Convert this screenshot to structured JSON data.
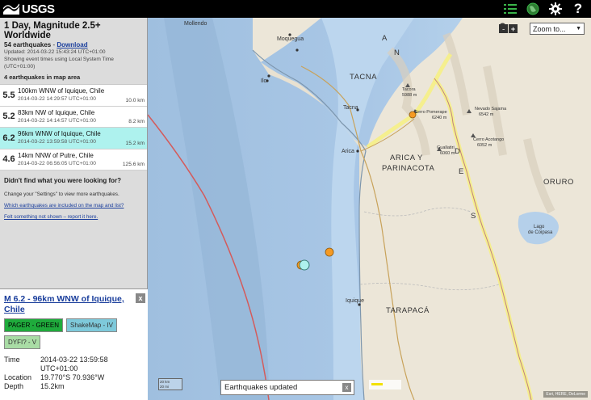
{
  "header": {
    "logo_text": "USGS",
    "icons": [
      "list-icon",
      "globe-icon",
      "gear-icon",
      "help-icon"
    ],
    "help_glyph": "?"
  },
  "summary": {
    "title": "1 Day, Magnitude 2.5+ Worldwide",
    "count": "54 earthquakes",
    "count_sep": " - ",
    "download": "Download",
    "updated": "Updated: 2014-03-22 15:43:24 UTC+01:00",
    "timezone_note": "Showing event times using Local System Time (UTC+01:00)",
    "in_area": "4 earthquakes in map area"
  },
  "earthquakes": [
    {
      "mag": "5.5",
      "place": "100km WNW of Iquique, Chile",
      "time": "2014-03-22 14:29:57 UTC+01:00",
      "depth": "10.0 km"
    },
    {
      "mag": "5.2",
      "place": "83km NW of Iquique, Chile",
      "time": "2014-03-22 14:14:57 UTC+01:00",
      "depth": "8.2 km"
    },
    {
      "mag": "6.2",
      "place": "96km WNW of Iquique, Chile",
      "time": "2014-03-22 13:59:58 UTC+01:00",
      "depth": "15.2 km"
    },
    {
      "mag": "4.6",
      "place": "14km NNW of Putre, Chile",
      "time": "2014-03-22 06:56:05 UTC+01:00",
      "depth": "125.6 km"
    }
  ],
  "help": {
    "heading": "Didn't find what you were looking for?",
    "settings_note": "Change your \"Settings\" to view more earthquakes.",
    "link1": "Which earthquakes are included on the map and list?",
    "link2": "Felt something not shown – report it here."
  },
  "details": {
    "title": "M 6.2 - 96km WNW of Iquique, Chile",
    "close": "x",
    "pager": "PAGER - GREEN",
    "shakemap": "ShakeMap - IV",
    "dyfi": "DYFI? - V",
    "time_label": "Time",
    "time_value": "2014-03-22 13:59:58",
    "time_tz": "UTC+01:00",
    "location_label": "Location",
    "location_value": "19.770°S 70.936°W",
    "depth_label": "Depth",
    "depth_value": "15.2km"
  },
  "map": {
    "zoom_in": "+",
    "zoom_out": "-",
    "zoom_select": "Zoom to...",
    "toast": "Earthquakes updated",
    "toast_close": "x",
    "scale_top": "20 km",
    "scale_bottom": "20 mi",
    "attribution": "Esri, HERE, DeLorme",
    "labels": {
      "mollendo": "Mollendo",
      "moquegua": "Moquegua",
      "ilo": "Ilo",
      "tacna_region": "TACNA",
      "tacna": "Tacna",
      "tacora": "Tacora",
      "tacora_elev": "5988 m",
      "pomerape": "Cerro Pomerape",
      "pomerape_elev": "6240 m",
      "sajama": "Nevado Sajama",
      "sajama_elev": "6542 m",
      "acotango": "Cerro Acotango",
      "acotango_elev": "6052 m",
      "guallatiri": "Guallatiri",
      "guallatiri_elev": "6060 m",
      "arica": "Arica",
      "arica_region": "ARICA Y",
      "parinacota": "PARINACOTA",
      "oruro": "ORURO",
      "lago": "Lago",
      "coipasa": "de Coipasa",
      "iquique": "Iquique",
      "tarapaca": "TARAPACÁ",
      "andes_a": "A",
      "andes_n": "N",
      "andes_d": "D",
      "andes_e": "E",
      "andes_s": "S"
    },
    "colors": {
      "ocean": "#b5d0ea",
      "land": "#ebe4d6",
      "quake_orange": "#f59a23",
      "quake_selected": "#aef2ee",
      "border": "#f6ef86",
      "plate_boundary": "#d45b5b"
    }
  }
}
